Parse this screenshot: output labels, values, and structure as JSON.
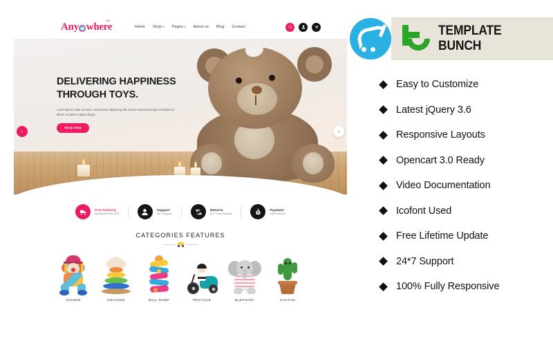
{
  "preview": {
    "header": {
      "logo_text_left": "Any",
      "logo_text_right": "where",
      "logo_superscript": "toys",
      "nav": [
        {
          "label": "Home",
          "has_caret": false
        },
        {
          "label": "Shop",
          "has_caret": true
        },
        {
          "label": "Pages",
          "has_caret": true
        },
        {
          "label": "About us",
          "has_caret": false
        },
        {
          "label": "Blog",
          "has_caret": false
        },
        {
          "label": "Contact",
          "has_caret": false
        }
      ],
      "icons": [
        {
          "name": "search-icon",
          "color": "#ec1c62"
        },
        {
          "name": "account-icon",
          "color": "#141414"
        },
        {
          "name": "cart-icon",
          "color": "#141414"
        }
      ]
    },
    "hero": {
      "heading_line1": "DELIVERING HAPPINESS",
      "heading_line2": "THROUGH TOYS.",
      "paragraph": "Lorem ipsum dolor sit amet, consectetur adipiscing elit, sed do eiusmod tempor incididunt ut labore et dolore magna aliqua.",
      "button_label": "Shop Now",
      "prev_arrow": "‹",
      "next_arrow": "›"
    },
    "services": [
      {
        "title": "Free Delivery",
        "subtitle": "Worldwide From $75",
        "icon": "truck-icon",
        "accent": "#ec1c62"
      },
      {
        "title": "Support",
        "subtitle": "24*7 Support",
        "icon": "user-support-icon",
        "accent": "#141414"
      },
      {
        "title": "Returns",
        "subtitle": "24*7 Free Returns",
        "icon": "returns-icon",
        "accent": "#141414"
      },
      {
        "title": "Payment",
        "subtitle": "100% Secure",
        "icon": "money-bag-icon",
        "accent": "#141414"
      }
    ],
    "categories": {
      "title": "CATEGORIES FEATURES",
      "items": [
        {
          "name": "JOCKER"
        },
        {
          "name": "CRAYONS"
        },
        {
          "name": "BALL RAMP"
        },
        {
          "name": "TRICYCLE"
        },
        {
          "name": "ELEPHANT"
        },
        {
          "name": "CACTUS"
        }
      ]
    }
  },
  "panel": {
    "brand_name": "TEMPLATE BUNCH",
    "opencart_logo": "opencart-cart-icon",
    "band_color": "#e8e4d9",
    "brand_green": "#2aa52a",
    "opencart_blue": "#2bb0e4",
    "bullet_glyph": "◆",
    "features": [
      "Easy to Customize",
      "Latest jQuery 3.6",
      "Responsive Layouts",
      "Opencart 3.0 Ready",
      "Video Documentation",
      "Icofont Used",
      "Free Lifetime Update",
      "24*7 Support",
      "100% Fully Responsive"
    ]
  }
}
